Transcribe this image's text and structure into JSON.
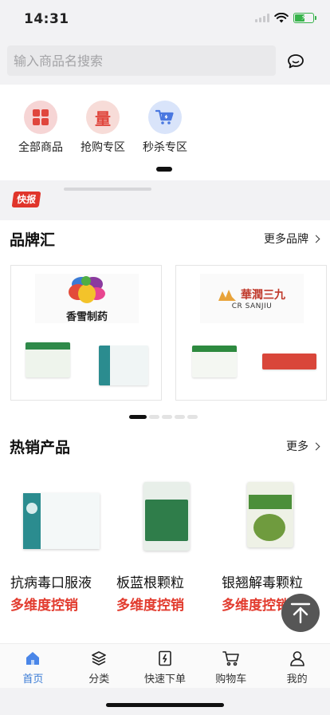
{
  "status": {
    "time": "14:31",
    "battery_level": 0.55
  },
  "search": {
    "placeholder": "输入商品名搜索",
    "message_icon": "chat-bubble-icon"
  },
  "categories": [
    {
      "label": "全部商品",
      "icon": "grid-icon",
      "color": "#f6d5d5"
    },
    {
      "label": "抢购专区",
      "icon": "liang-icon",
      "glyph": "量",
      "color": "#f7dcd8"
    },
    {
      "label": "秒杀专区",
      "icon": "cart-icon",
      "color": "#d9e4fa"
    }
  ],
  "news": {
    "badge": "快报"
  },
  "brands": {
    "title": "品牌汇",
    "more": "更多品牌",
    "cards": [
      {
        "name": "香雪制药"
      },
      {
        "name": "華潤三九",
        "sub": "CR SANJIU"
      }
    ]
  },
  "hot": {
    "title": "热销产品",
    "more": "更多",
    "products": [
      {
        "name": "抗病毒口服液",
        "tag": "多维度控销"
      },
      {
        "name": "板蓝根颗粒",
        "tag": "多维度控销"
      },
      {
        "name": "银翘解毒颗粒",
        "tag": "多维度控销"
      }
    ]
  },
  "tabs": [
    {
      "label": "首页",
      "icon": "home-icon",
      "active": true
    },
    {
      "label": "分类",
      "icon": "layers-icon"
    },
    {
      "label": "快速下单",
      "icon": "quick-order-icon"
    },
    {
      "label": "购物车",
      "icon": "shopping-cart-icon"
    },
    {
      "label": "我的",
      "icon": "user-icon"
    }
  ],
  "colors": {
    "accent": "#3a7bd5",
    "promo_red": "#e23b2e",
    "badge_red": "#e0352b"
  }
}
